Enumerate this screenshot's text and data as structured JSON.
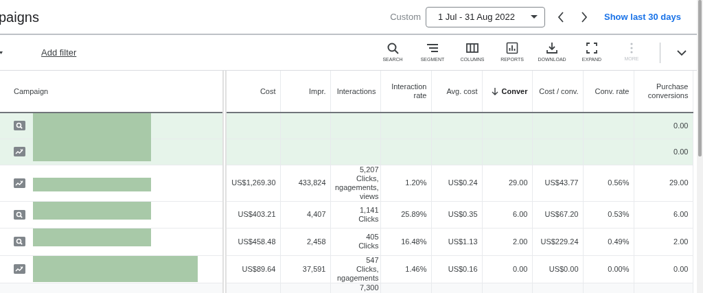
{
  "header": {
    "title": "paigns",
    "range_label": "Custom",
    "date_range": "1 Jul - 31 Aug 2022",
    "show_last": "Show last 30 days"
  },
  "toolbar": {
    "add_filter": "Add filter",
    "tools": [
      {
        "kind": "search",
        "label": "SEARCH",
        "disabled": false
      },
      {
        "kind": "segment",
        "label": "SEGMENT",
        "disabled": false
      },
      {
        "kind": "columns",
        "label": "COLUMNS",
        "disabled": false
      },
      {
        "kind": "reports",
        "label": "REPORTS",
        "disabled": false
      },
      {
        "kind": "download",
        "label": "DOWNLOAD",
        "disabled": false
      },
      {
        "kind": "expand",
        "label": "EXPAND",
        "disabled": false
      },
      {
        "kind": "more",
        "label": "MORE",
        "disabled": true
      }
    ]
  },
  "table": {
    "columns": [
      {
        "label": "Campaign",
        "sorted": false
      },
      {
        "label": "Cost",
        "sorted": false
      },
      {
        "label": "Impr.",
        "sorted": false
      },
      {
        "label": "Interactions",
        "sorted": false
      },
      {
        "label": "Interaction rate",
        "sorted": false
      },
      {
        "label": "Avg. cost",
        "sorted": false
      },
      {
        "label": "Conver",
        "sorted": true
      },
      {
        "label": "Cost / conv.",
        "sorted": false
      },
      {
        "label": "Conv. rate",
        "sorted": false
      },
      {
        "label": "Purchase conversions",
        "sorted": false
      }
    ],
    "rows": [
      {
        "kind": "search",
        "highlighted": true,
        "cells": [
          "",
          "",
          "",
          [],
          "",
          "",
          "",
          "",
          "",
          "0.00"
        ]
      },
      {
        "kind": "display",
        "highlighted": true,
        "cells": [
          "",
          "",
          "",
          [],
          "",
          "",
          "",
          "",
          "",
          "0.00"
        ]
      },
      {
        "kind": "display",
        "highlighted": false,
        "cells": [
          "",
          "US$1,269.30",
          "433,824",
          [
            "5,207",
            "Clicks,",
            "ngagements,",
            "views"
          ],
          "1.20%",
          "US$0.24",
          "29.00",
          "US$43.77",
          "0.56%",
          "29.00"
        ]
      },
      {
        "kind": "search",
        "highlighted": false,
        "cells": [
          "",
          "US$403.21",
          "4,407",
          [
            "1,141",
            "Clicks"
          ],
          "25.89%",
          "US$0.35",
          "6.00",
          "US$67.20",
          "0.53%",
          "6.00"
        ]
      },
      {
        "kind": "search",
        "highlighted": false,
        "cells": [
          "",
          "US$458.48",
          "2,458",
          [
            "405",
            "Clicks"
          ],
          "16.48%",
          "US$1.13",
          "2.00",
          "US$229.24",
          "0.49%",
          "2.00"
        ]
      },
      {
        "kind": "display",
        "highlighted": false,
        "cells": [
          "",
          "US$89.64",
          "37,591",
          [
            "547",
            "Clicks,",
            "ngagements"
          ],
          "1.46%",
          "US$0.16",
          "0.00",
          "US$0.00",
          "0.00%",
          "0.00"
        ]
      },
      {
        "kind": "total",
        "highlighted": false,
        "cells": [
          "",
          "",
          "",
          [
            "7,300"
          ],
          "",
          "",
          "",
          "",
          "",
          ""
        ]
      }
    ]
  }
}
